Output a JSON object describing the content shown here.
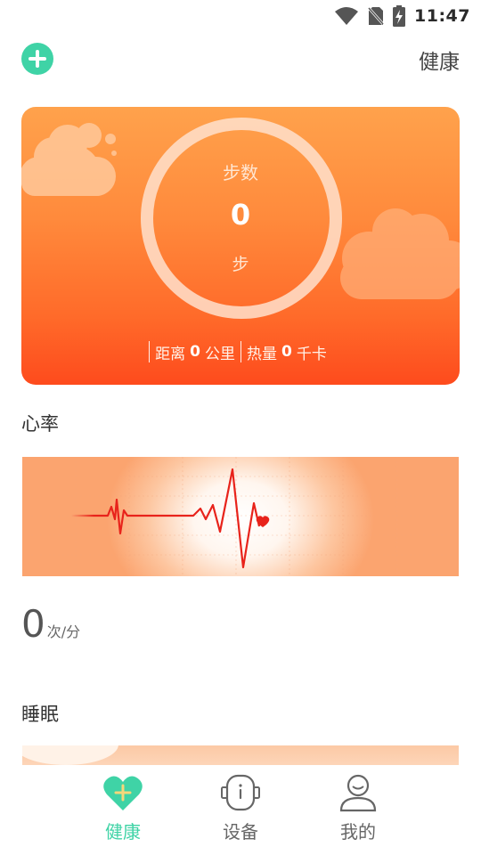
{
  "status_bar": {
    "time": "11:47",
    "icons": [
      "wifi-icon",
      "no-sim-icon",
      "battery-charging-icon"
    ]
  },
  "header": {
    "add_icon": "plus-circle-icon",
    "title": "健康"
  },
  "steps": {
    "label": "步数",
    "value": "0",
    "unit": "步",
    "distance_label": "距离",
    "distance_value": "0",
    "distance_unit": "公里",
    "calories_label": "热量",
    "calories_value": "0",
    "calories_unit": "千卡"
  },
  "heart_rate": {
    "title": "心率",
    "value": "0",
    "unit": "次/分"
  },
  "sleep": {
    "title": "睡眠"
  },
  "nav": {
    "items": [
      {
        "label": "健康",
        "icon": "heart-plus-icon",
        "active": true
      },
      {
        "label": "设备",
        "icon": "watch-device-icon",
        "active": false
      },
      {
        "label": "我的",
        "icon": "user-profile-icon",
        "active": false
      }
    ]
  },
  "colors": {
    "accent": "#3fd3a6",
    "card_top": "#ffa24c",
    "card_bottom": "#fe4b1d",
    "ecg_line": "#e8231b"
  }
}
